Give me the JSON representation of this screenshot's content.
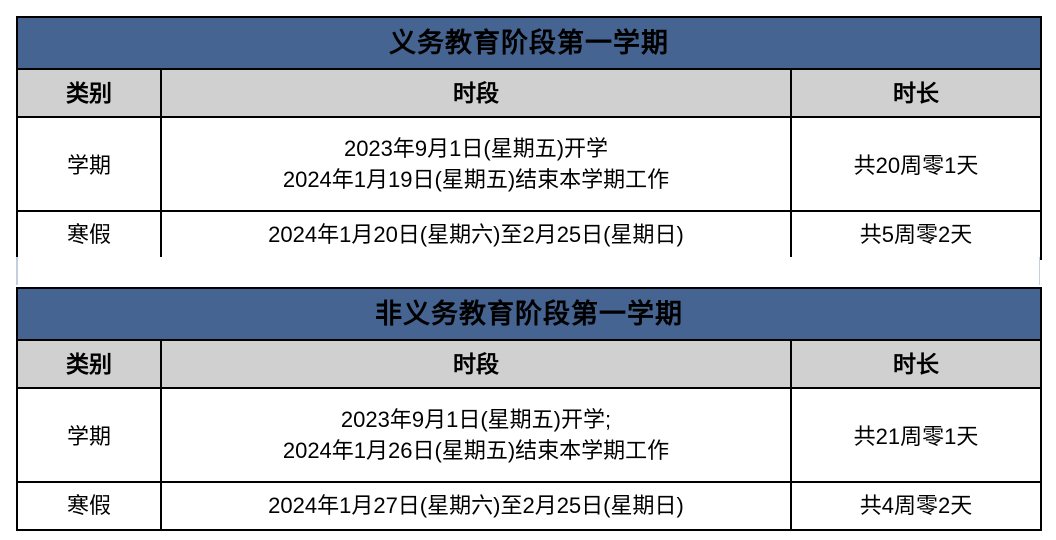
{
  "page": {
    "background_color": "#ffffff",
    "accent_color": "#466491",
    "header_row_color": "#d0d0d0",
    "border_color": "#000000"
  },
  "columns": {
    "category": "类别",
    "period": "时段",
    "duration": "时长"
  },
  "tables": [
    {
      "title": "义务教育阶段第一学期",
      "rows": [
        {
          "category": "学期",
          "period_line1": "2023年9月1日(星期五)开学",
          "period_line2": "2024年1月19日(星期五)结束本学期工作",
          "duration": "共20周零1天"
        },
        {
          "category": "寒假",
          "period_line1": "2024年1月20日(星期六)至2月25日(星期日)",
          "duration": "共5周零2天"
        }
      ]
    },
    {
      "title": "非义务教育阶段第一学期",
      "rows": [
        {
          "category": "学期",
          "period_line1": "2023年9月1日(星期五)开学;",
          "period_line2": "2024年1月26日(星期五)结束本学期工作",
          "duration": "共21周零1天"
        },
        {
          "category": "寒假",
          "period_line1": "2024年1月27日(星期六)至2月25日(星期日)",
          "duration": "共4周零2天"
        }
      ]
    }
  ]
}
